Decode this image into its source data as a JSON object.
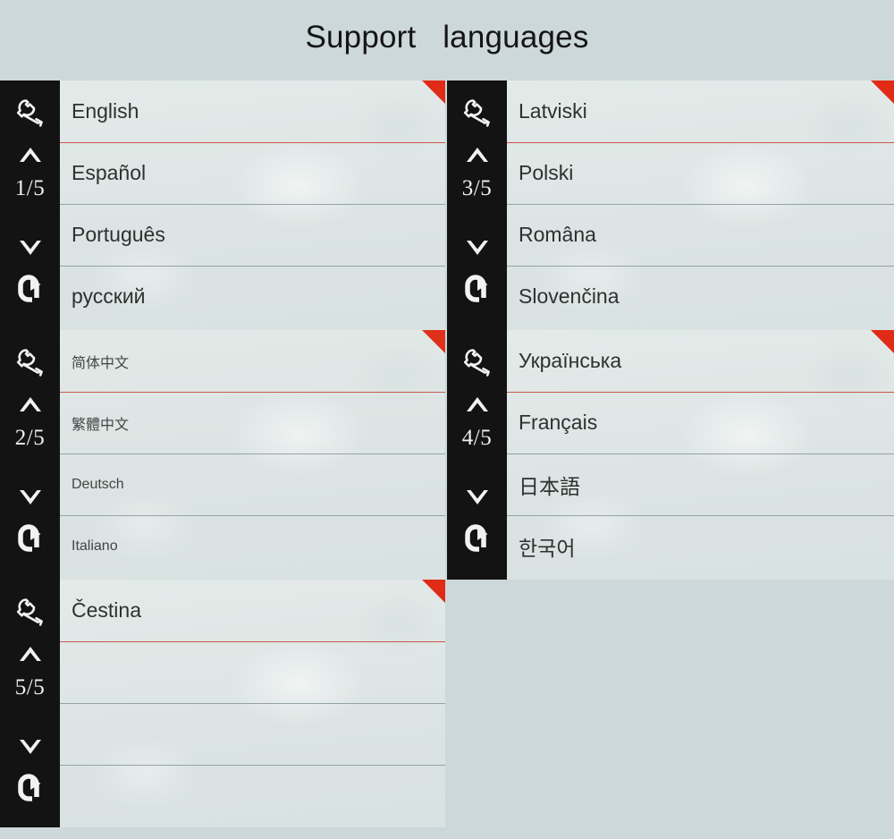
{
  "title": "Support   languages",
  "colors": {
    "page_background": "#ccd8da",
    "panel_background": "#dde5e4",
    "sidebar_background": "#131313",
    "corner_flag": "#e02b16",
    "active_separator": "#c8564a",
    "separator": "#93a3a4",
    "text": "#2d3130"
  },
  "sidebar_icons": {
    "settings": "wrench-icon",
    "up": "chevron-up-icon",
    "down": "chevron-down-icon",
    "enter": "return-arrow-icon"
  },
  "panels": [
    {
      "id": "panel-1",
      "page_indicator": "1/5",
      "rows": [
        "English",
        "Español",
        "Português",
        "русский"
      ]
    },
    {
      "id": "panel-2",
      "page_indicator": "2/5",
      "rows": [
        "简体中文",
        "繁體中文",
        "Deutsch",
        "Italiano"
      ]
    },
    {
      "id": "panel-3",
      "page_indicator": "3/5",
      "rows": [
        "Latviski",
        "Polski",
        "Româna",
        "Slovenčina"
      ]
    },
    {
      "id": "panel-4",
      "page_indicator": "4/5",
      "rows": [
        "Українська",
        "Français",
        "日本語",
        "한국어"
      ]
    },
    {
      "id": "panel-5",
      "page_indicator": "5/5",
      "rows": [
        "Čestina",
        "",
        "",
        ""
      ]
    }
  ]
}
